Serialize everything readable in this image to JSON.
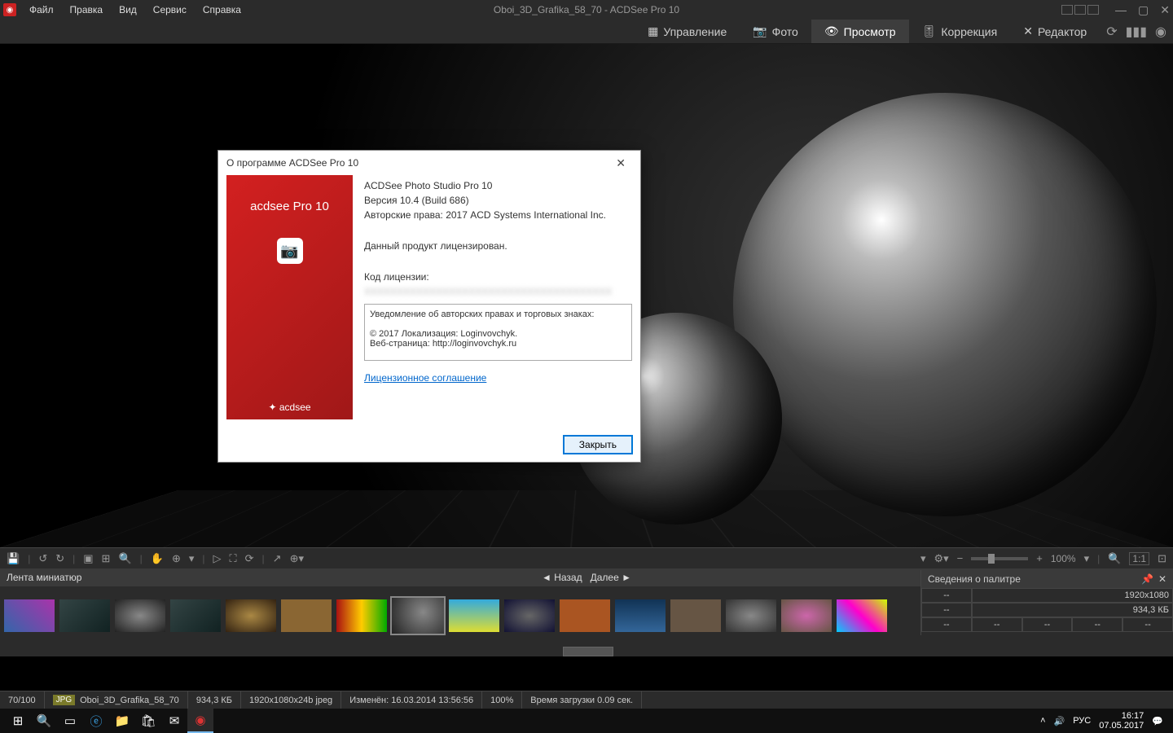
{
  "menubar": {
    "items": [
      "Файл",
      "Правка",
      "Вид",
      "Сервис",
      "Справка"
    ],
    "title": "Oboi_3D_Grafika_58_70 - ACDSee Pro 10"
  },
  "modes": {
    "manage": "Управление",
    "photo": "Фото",
    "view": "Просмотр",
    "correct": "Коррекция",
    "editor": "Редактор"
  },
  "thumbstrip": {
    "title": "Лента миниатюр",
    "back": "Назад",
    "forward": "Далее"
  },
  "palette": {
    "title": "Сведения о палитре",
    "dash": "--",
    "res": "1920x1080",
    "size": "934,3 КБ"
  },
  "zoom": "100%",
  "ratio": "1:1",
  "status": {
    "count": "70/100",
    "format": "JPG",
    "filename": "Oboi_3D_Grafika_58_70",
    "filesize": "934,3 КБ",
    "dims": "1920x1080x24b jpeg",
    "modified": "Изменён: 16.03.2014 13:56:56",
    "zoom": "100%",
    "loadtime": "Время загрузки 0.09 сек."
  },
  "taskbar": {
    "lang": "РУС",
    "time": "16:17",
    "date": "07.05.2017"
  },
  "dialog": {
    "title": "О программе ACDSee Pro 10",
    "brand": "acdsee Pro 10",
    "footbrand": "✦ acdsee",
    "product": "ACDSee Photo Studio Pro 10",
    "version": "Версия 10.4 (Build 686)",
    "copyright": "Авторские права: 2017 ACD Systems International Inc.",
    "licensed": "Данный продукт лицензирован.",
    "licensekey_label": "Код лицензии:",
    "notice_title": "Уведомление об авторских правах и торговых знаках:",
    "notice_line1": "© 2017 Локализация: Loginvovchyk.",
    "notice_line2": "Веб-страница: http://loginvovchyk.ru",
    "agreement": "Лицензионное соглашение",
    "close_btn": "Закрыть"
  }
}
